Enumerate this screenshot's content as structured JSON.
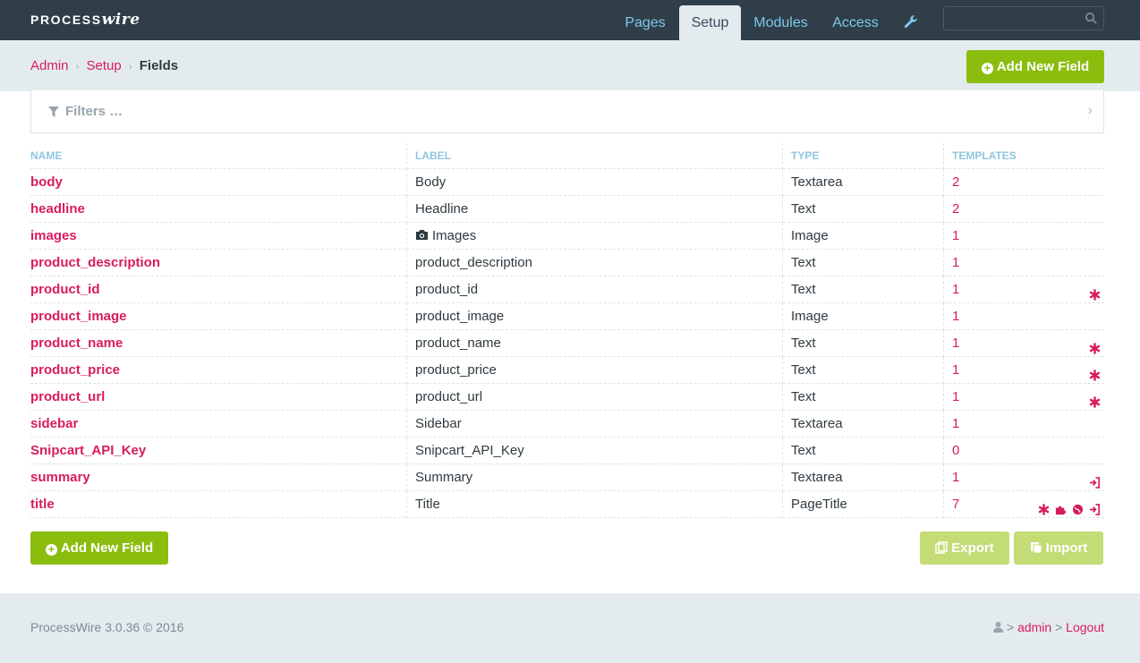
{
  "app": {
    "logo_part1": "PROCESS",
    "logo_part2": "wire"
  },
  "nav": {
    "items": [
      {
        "label": "Pages"
      },
      {
        "label": "Setup"
      },
      {
        "label": "Modules"
      },
      {
        "label": "Access"
      }
    ],
    "active": "Setup",
    "search_placeholder": ""
  },
  "breadcrumb": {
    "items": [
      "Admin",
      "Setup"
    ],
    "current": "Fields"
  },
  "actions": {
    "add_new_field": "Add New Field",
    "export": "Export",
    "import": "Import"
  },
  "filters": {
    "label": "Filters …"
  },
  "table": {
    "headers": [
      "NAME",
      "LABEL",
      "TYPE",
      "TEMPLATES"
    ],
    "rows": [
      {
        "name": "body",
        "label": "Body",
        "type": "Textarea",
        "templates": "2",
        "flags": []
      },
      {
        "name": "headline",
        "label": "Headline",
        "type": "Text",
        "templates": "2",
        "flags": []
      },
      {
        "name": "images",
        "label": "Images",
        "type": "Image",
        "templates": "1",
        "flags": [],
        "label_icon": "camera-icon"
      },
      {
        "name": "product_description",
        "label": "product_description",
        "type": "Text",
        "templates": "1",
        "flags": []
      },
      {
        "name": "product_id",
        "label": "product_id",
        "type": "Text",
        "templates": "1",
        "flags": [
          "asterisk-icon"
        ]
      },
      {
        "name": "product_image",
        "label": "product_image",
        "type": "Image",
        "templates": "1",
        "flags": []
      },
      {
        "name": "product_name",
        "label": "product_name",
        "type": "Text",
        "templates": "1",
        "flags": [
          "asterisk-icon"
        ]
      },
      {
        "name": "product_price",
        "label": "product_price",
        "type": "Text",
        "templates": "1",
        "flags": [
          "asterisk-icon"
        ]
      },
      {
        "name": "product_url",
        "label": "product_url",
        "type": "Text",
        "templates": "1",
        "flags": [
          "asterisk-icon"
        ]
      },
      {
        "name": "sidebar",
        "label": "Sidebar",
        "type": "Textarea",
        "templates": "1",
        "flags": []
      },
      {
        "name": "Snipcart_API_Key",
        "label": "Snipcart_API_Key",
        "type": "Text",
        "templates": "0",
        "flags": []
      },
      {
        "name": "summary",
        "label": "Summary",
        "type": "Textarea",
        "templates": "1",
        "flags": [
          "sign-in-icon"
        ]
      },
      {
        "name": "title",
        "label": "Title",
        "type": "PageTitle",
        "templates": "7",
        "flags": [
          "asterisk-icon",
          "puzzle-icon",
          "globe-icon",
          "sign-in-icon"
        ]
      }
    ]
  },
  "footer": {
    "version": "ProcessWire 3.0.36 © 2016",
    "user": "admin",
    "logout": "Logout"
  },
  "colors": {
    "topbar": "#2f3e48",
    "accent_pink": "#d81b60",
    "green": "#8bbd0f",
    "light_green": "#c3dc76",
    "band": "#e4ebee",
    "nav_link": "#7fc7ee"
  }
}
